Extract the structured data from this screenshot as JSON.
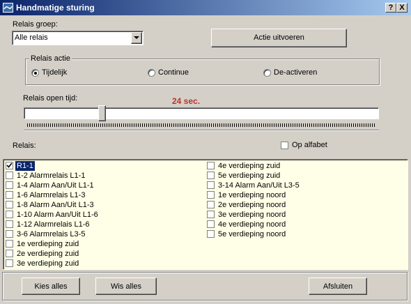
{
  "window": {
    "title": "Handmatige sturing"
  },
  "titlebar_buttons": {
    "help": "?",
    "close": "X"
  },
  "relay_group": {
    "label": "Relais groep:",
    "selected": "Alle relais"
  },
  "execute_button": "Actie uitvoeren",
  "relay_action": {
    "legend": "Relais actie",
    "options": [
      "Tijdelijk",
      "Continue",
      "De-activeren"
    ],
    "selected_index": 0
  },
  "open_time": {
    "label": "Relais open tijd:",
    "value_text": "24 sec.",
    "value_color": "#c03030",
    "slider_fraction": 0.21
  },
  "relays": {
    "label": "Relais:",
    "alphabetic_label": "Op alfabet",
    "alphabetic_checked": false,
    "column1": [
      "R1-1",
      "1-2 Alarmrelais L1-1",
      "1-4 Alarm Aan/Uit L1-1",
      "1-6 Alarmrelais L1-3",
      "1-8  Alarm Aan/Uit L1-3",
      "1-10 Alarm Aan/Uit L1-6",
      "1-12  Alarmrelais L1-6",
      "3-6 Alarmrelais L3-5",
      "1e verdieping zuid",
      "2e verdieping zuid",
      "3e verdieping zuid"
    ],
    "column2": [
      "4e verdieping zuid",
      "5e verdieping zuid",
      "3-14  Alarm Aan/Uit L3-5",
      "1e verdieping noord",
      "2e verdieping noord",
      "3e verdieping noord",
      "4e verdieping noord",
      "5e verdieping noord"
    ],
    "checked_items": [
      "R1-1"
    ],
    "selected_item": "R1-1",
    "list_background": "#ffffe7"
  },
  "footer": {
    "select_all": "Kies alles",
    "clear_all": "Wis alles",
    "close": "Afsluiten"
  }
}
